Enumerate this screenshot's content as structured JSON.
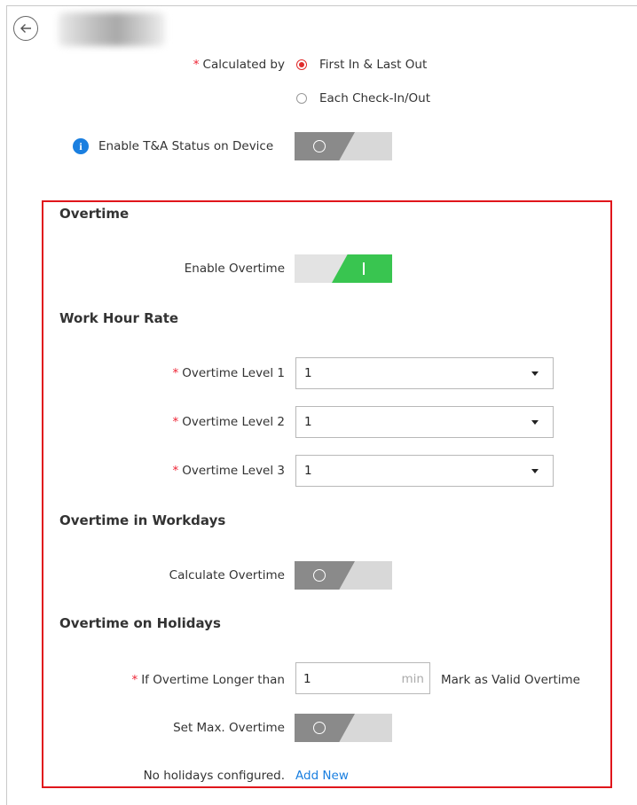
{
  "header": {
    "back_label": "Back"
  },
  "calculated_by": {
    "label": "Calculated by",
    "options": [
      {
        "label": "First In & Last Out",
        "selected": true
      },
      {
        "label": "Each Check-In/Out",
        "selected": false
      }
    ]
  },
  "ta_status": {
    "label": "Enable T&A Status on Device",
    "enabled": false
  },
  "overtime": {
    "title": "Overtime",
    "enable_label": "Enable Overtime",
    "enabled": true
  },
  "work_hour_rate": {
    "title": "Work Hour Rate",
    "levels": [
      {
        "label": "Overtime Level 1",
        "value": "1"
      },
      {
        "label": "Overtime Level 2",
        "value": "1"
      },
      {
        "label": "Overtime Level 3",
        "value": "1"
      }
    ]
  },
  "workdays": {
    "title": "Overtime in Workdays",
    "calc_label": "Calculate Overtime",
    "enabled": false
  },
  "holidays": {
    "title": "Overtime on Holidays",
    "longer_label": "If Overtime Longer than",
    "longer_value": "1",
    "unit": "min",
    "suffix": "Mark as Valid Overtime",
    "max_label": "Set Max. Overtime",
    "max_enabled": false,
    "empty_text": "No holidays configured.",
    "add_new": "Add New"
  },
  "colors": {
    "accent_green": "#39c550",
    "required_red": "#e02a2a",
    "link_blue": "#1a7fe0",
    "highlight_red": "#e0161b"
  }
}
